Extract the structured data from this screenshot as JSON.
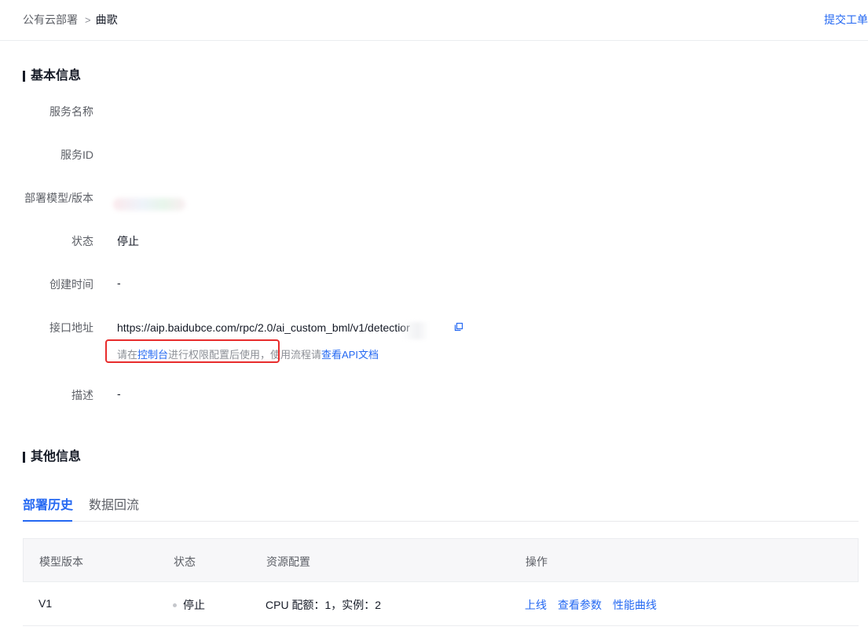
{
  "breadcrumb": {
    "parent": "公有云部署",
    "separator": ">",
    "current": "曲歌"
  },
  "header": {
    "submit_ticket": "提交工单"
  },
  "basic_info": {
    "title": "基本信息",
    "rows": {
      "service_name": {
        "label": "服务名称",
        "value": ""
      },
      "service_id": {
        "label": "服务ID",
        "value": ""
      },
      "model_version": {
        "label": "部署模型/版本",
        "value": ""
      },
      "status": {
        "label": "状态",
        "value": "停止"
      },
      "created_at": {
        "label": "创建时间",
        "value": "-"
      },
      "api_url": {
        "label": "接口地址",
        "value": "https://aip.baidubce.com/rpc/2.0/ai_custom_bml/v1/detectior"
      },
      "description": {
        "label": "描述",
        "value": "-"
      }
    },
    "hint": {
      "pre": "请在",
      "console_link": "控制台",
      "mid": "进行权限配置后使用，使用流程请",
      "doc_link": "查看API文档"
    }
  },
  "other_info": {
    "title": "其他信息",
    "tabs": [
      {
        "label": "部署历史",
        "active": true
      },
      {
        "label": "数据回流",
        "active": false
      }
    ],
    "table": {
      "headers": [
        "模型版本",
        "状态",
        "资源配置",
        "操作"
      ],
      "rows": [
        {
          "version": "V1",
          "status": "停止",
          "resources": "CPU 配额：1，实例：2",
          "actions": [
            "上线",
            "查看参数",
            "性能曲线"
          ]
        }
      ]
    }
  },
  "colors": {
    "link": "#2468f2",
    "highlight_box": "#e82c2c",
    "text": "#151a26",
    "muted": "#5c5f66"
  }
}
